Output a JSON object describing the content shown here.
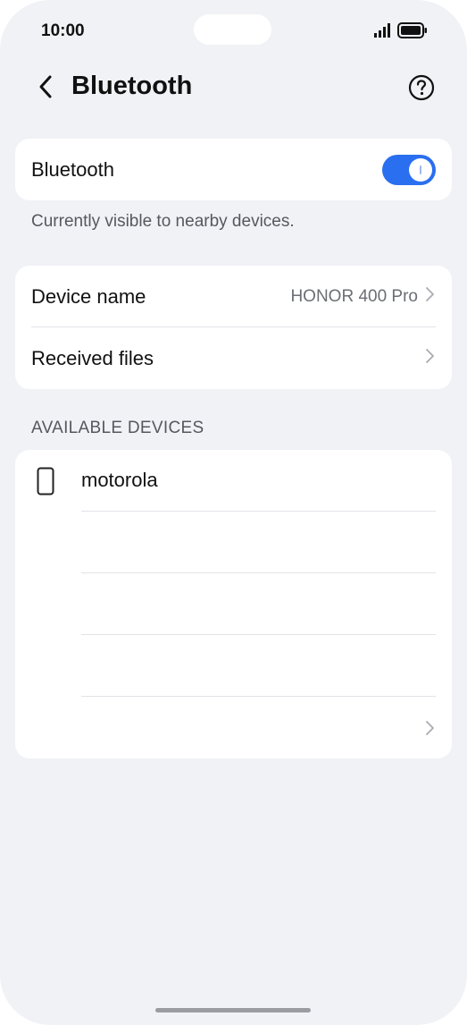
{
  "status_bar": {
    "time": "10:00",
    "icons": [
      "signal-icon",
      "battery-icon"
    ]
  },
  "header": {
    "title": "Bluetooth",
    "back_icon": "chevron-left-icon",
    "help_icon": "help-circle-icon"
  },
  "bluetooth_card": {
    "label": "Bluetooth",
    "toggle_on": true
  },
  "hint": "Currently visible to nearby devices.",
  "settings_card": {
    "rows": [
      {
        "label": "Device name",
        "value": "HONOR 400 Pro"
      },
      {
        "label": "Received files",
        "value": ""
      }
    ]
  },
  "available_devices": {
    "header": "AVAILABLE DEVICES",
    "devices": [
      {
        "name": "motorola",
        "icon": "phone-icon"
      },
      {
        "name": ""
      },
      {
        "name": ""
      },
      {
        "name": ""
      },
      {
        "name": ""
      }
    ]
  },
  "colors": {
    "accent": "#2a6ff0",
    "background": "#f1f2f6",
    "card": "#ffffff",
    "primary_text": "#111111",
    "secondary_text": "#55585e"
  }
}
